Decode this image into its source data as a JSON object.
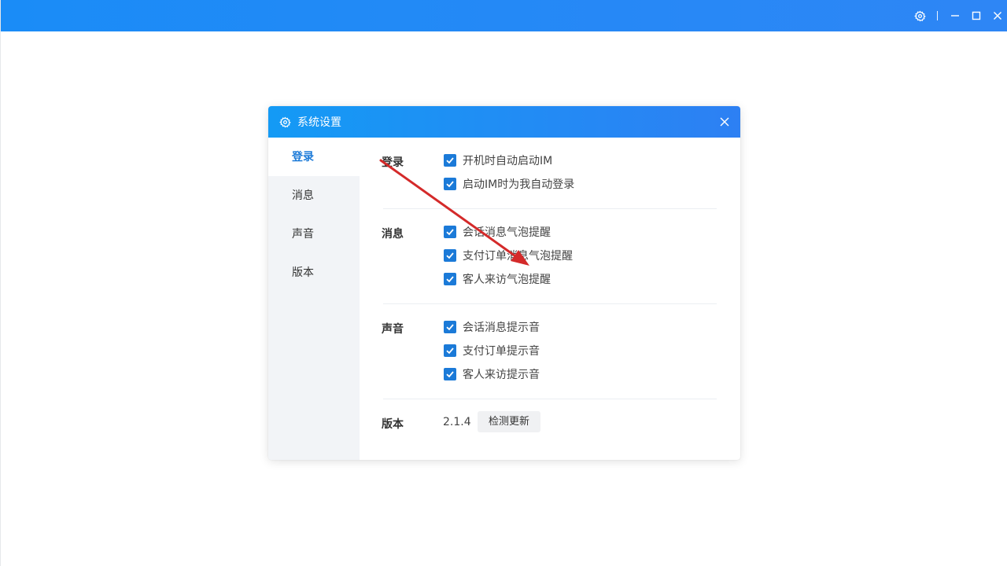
{
  "window": {
    "controls": {
      "settings_icon": "gear-icon",
      "minimize_icon": "minimize-icon",
      "maximize_icon": "maximize-icon",
      "close_icon": "close-icon"
    },
    "accent": "#2e86f5"
  },
  "dialog": {
    "title": "系统设置",
    "title_icon": "gear-icon",
    "close_icon": "close-icon",
    "sidebar": {
      "items": [
        {
          "label": "登录",
          "active": true
        },
        {
          "label": "消息",
          "active": false
        },
        {
          "label": "声音",
          "active": false
        },
        {
          "label": "版本",
          "active": false
        }
      ]
    },
    "sections": {
      "login": {
        "label": "登录",
        "options": [
          {
            "label": "开机时自动启动IM",
            "checked": true
          },
          {
            "label": "启动IM时为我自动登录",
            "checked": true
          }
        ]
      },
      "message": {
        "label": "消息",
        "options": [
          {
            "label": "会话消息气泡提醒",
            "checked": true
          },
          {
            "label": "支付订单消息气泡提醒",
            "checked": true
          },
          {
            "label": "客人来访气泡提醒",
            "checked": true
          }
        ]
      },
      "sound": {
        "label": "声音",
        "options": [
          {
            "label": "会话消息提示音",
            "checked": true
          },
          {
            "label": "支付订单提示音",
            "checked": true
          },
          {
            "label": "客人来访提示音",
            "checked": true
          }
        ]
      },
      "version": {
        "label": "版本",
        "value": "2.1.4",
        "check_button": "检测更新"
      }
    },
    "colors": {
      "header_start": "#149af5",
      "header_end": "#2d80f3",
      "checkbox": "#1b7ad8",
      "active_nav": "#1b7ad8",
      "annotation_arrow": "#d42a2a"
    }
  }
}
